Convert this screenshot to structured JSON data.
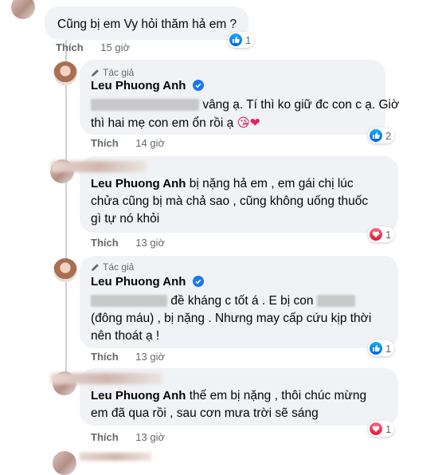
{
  "comments": [
    {
      "id": "c1",
      "name": "",
      "text": "Cũng bị em Vy hỏi thăm hả em ?",
      "action": "Thích",
      "time": "15 giờ",
      "reaction": "like",
      "count": "1"
    },
    {
      "id": "c2",
      "tag": "Tác giả",
      "name": "Leu Phuong Anh",
      "text_line1": "vâng ạ. Tí thì ko giữ đc con c ạ. Giờ",
      "text_line2": "thì hai mẹ con em ổn rồi ạ",
      "emojis": "😘❤",
      "action": "Thích",
      "time": "14 giờ",
      "reaction": "like",
      "count": "2"
    },
    {
      "id": "c3",
      "name": "Leu Phuong Anh",
      "text_line1": "bị nặng hả em , em gái chị lúc",
      "text_line2": "chửa cũng bị mà chả sao , cũng không uống thuốc",
      "text_line3": "gì tự nó khỏi",
      "action": "Thích",
      "time": "13 giờ",
      "reaction": "love",
      "count": "1"
    },
    {
      "id": "c4",
      "tag": "Tác giả",
      "name": "Leu Phuong Anh",
      "text_line1": "đề kháng c tốt á . E bị con",
      "text_line2": "(đông máu) , bị nặng . Nhưng may cấp cứu kịp thời",
      "text_line3": "nên thoát ạ !",
      "action": "Thích",
      "time": "13 giờ",
      "reaction": "like",
      "count": "1"
    },
    {
      "id": "c5",
      "name": "Leu Phuong Anh",
      "text_line1": "thế em bị nặng , thôi chúc mừng",
      "text_line2": "em đã qua rồi , sau cơn mưa trời sẽ sáng",
      "action": "Thích",
      "time": "13 giờ",
      "reaction": "love",
      "count": "1"
    }
  ],
  "colors": {
    "bubble": "#f0f2f5",
    "like": "#1877f2",
    "love": "#f33e58",
    "meta": "#65676b"
  }
}
